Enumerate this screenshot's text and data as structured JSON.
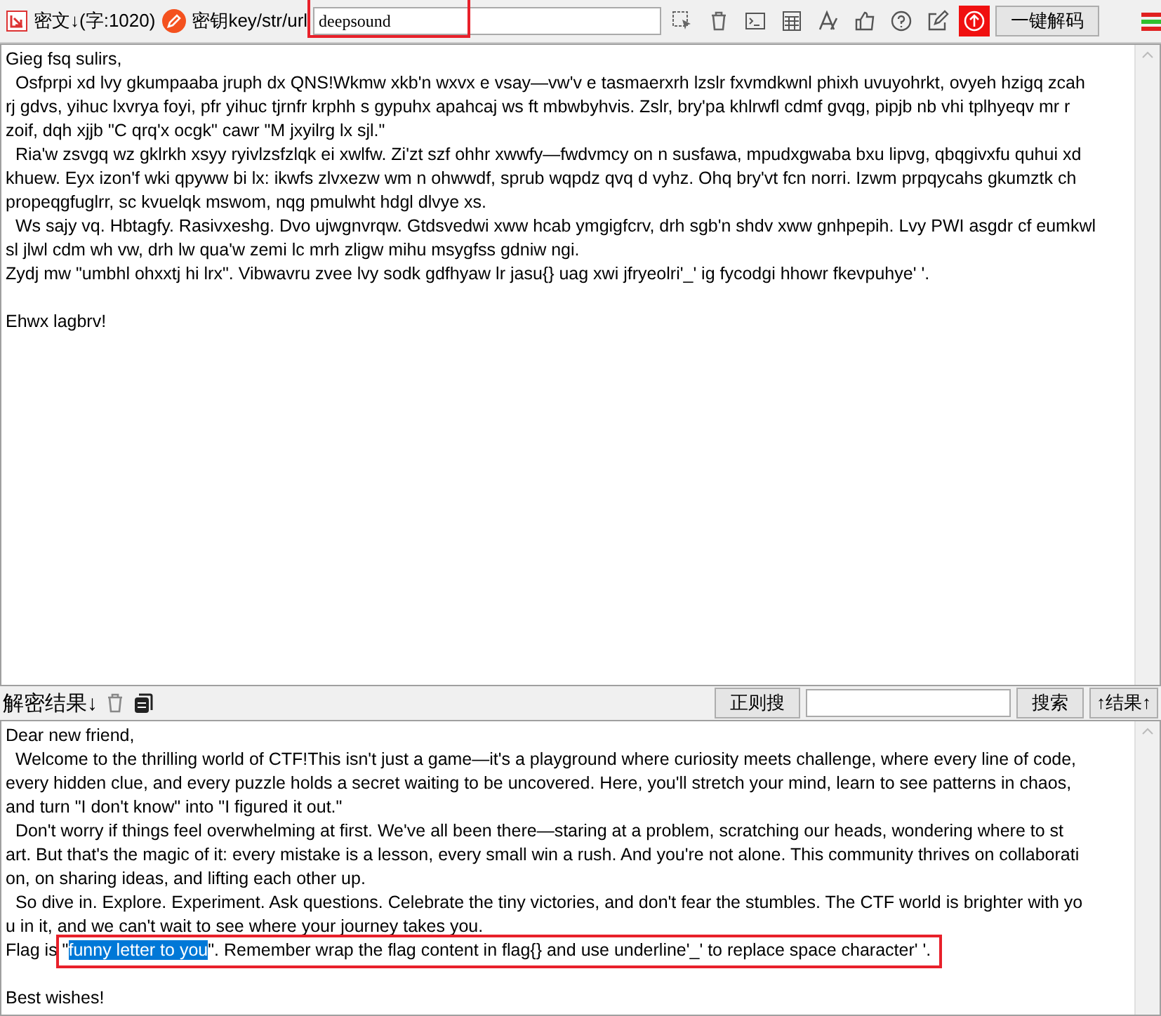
{
  "toolbar": {
    "cipher_label": "密文↓(字:1020)",
    "key_label": "密钥key/str/url",
    "key_value": "deepsound",
    "key_highlighted": true,
    "decode_button": "一键解码"
  },
  "cipher": {
    "lines": [
      "Gieg fsq sulirs,",
      "  Osfprpi xd lvy gkumpaaba jruph dx QNS!Wkmw xkb'n wxvx e vsay—vw'v e tasmaerxrh lzslr fxvmdkwnl phixh uvuyohrkt, ovyeh hzigq zcah",
      "rj gdvs, yihuc lxvrya foyi, pfr yihuc tjrnfr krphh s gypuhx apahcaj ws ft mbwbyhvis. Zslr, bry'pa khlrwfl cdmf gvqg, pipjb nb vhi tplhyeqv mr r",
      "zoif, dqh xjjb \"C qrq'x ocgk\" cawr \"M jxyilrg lx sjl.\"",
      "  Ria'w zsvgq wz gklrkh xsyy ryivlzsfzlqk ei xwlfw. Zi'zt szf ohhr xwwfy—fwdvmcy on n susfawa, mpudxgwaba bxu lipvg, qbqgivxfu quhui xd",
      "khuew. Eyx izon'f wki qpyww bi lx: ikwfs zlvxezw wm n ohwwdf, sprub wqpdz qvq d vyhz. Ohq bry'vt fcn norri. Izwm prpqycahs gkumztk ch",
      "propeqgfuglrr, sc kvuelqk mswom, nqg pmulwht hdgl dlvye xs.",
      "  Ws sajy vq. Hbtagfy. Rasivxeshg. Dvo ujwgnvrqw. Gtdsvedwi xww hcab ymgigfcrv, drh sgb'n shdv xww gnhpepih. Lvy PWI asgdr cf eumkwl",
      "sl jlwl cdm wh vw, drh lw qua'w zemi lc mrh zligw mihu msygfss gdniw ngi.",
      "Zydj mw \"umbhl ohxxtj hi lrx\". Vibwavru zvee lvy sodk gdfhyaw lr jasu{} uag xwi jfryeolri'_' ig fycodgi hhowr fkevpuhye' '."
    ],
    "closing": "Ehwx lagbrv!"
  },
  "result_bar": {
    "label": "解密结果↓",
    "regex_button": "正则搜",
    "search_button": "搜索",
    "result_button": "↑结果↑"
  },
  "result": {
    "lines": [
      "Dear new friend,",
      "  Welcome to the thrilling world of CTF!This isn't just a game—it's a playground where curiosity meets challenge, where every line of code,",
      "every hidden clue, and every puzzle holds a secret waiting to be uncovered. Here, you'll stretch your mind, learn to see patterns in chaos,",
      "and turn \"I don't know\" into \"I figured it out.\"",
      "  Don't worry if things feel overwhelming at first. We've all been there—staring at a problem, scratching our heads, wondering where to st",
      "art. But that's the magic of it: every mistake is a lesson, every small win a rush. And you're not alone. This community thrives on collaborati",
      "on, on sharing ideas, and lifting each other up.",
      "  So dive in. Explore. Experiment. Ask questions. Celebrate the tiny victories, and don't fear the stumbles. The CTF world is brighter with yo",
      "u in it, and we can't wait to see where your journey takes you."
    ],
    "flag_line": {
      "before": "Flag is \"",
      "selected": "funny letter to you",
      "after": "\". Remember wrap the flag content in flag{} and use underline'_' to replace space character' '.",
      "highlighted": true
    },
    "closing": "Best wishes!"
  }
}
